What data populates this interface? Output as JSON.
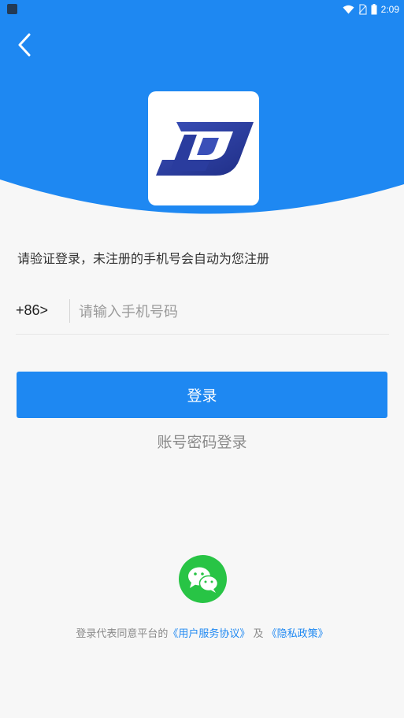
{
  "colors": {
    "header_blue": "#1e88f2",
    "button_blue": "#1e88f2",
    "wechat_green": "#28c445",
    "link_blue": "#1e88f2"
  },
  "status_bar": {
    "time": "2:09",
    "icons": [
      "app-notification-icon",
      "wifi-icon",
      "no-sim-icon",
      "battery-icon"
    ]
  },
  "header": {
    "back_icon": "chevron-left-icon",
    "logo_icon": "ld-logo"
  },
  "login": {
    "hint": "请验证登录，未注册的手机号会自动为您注册",
    "country_code": "+86>",
    "phone_placeholder": "请输入手机号码",
    "phone_value": "",
    "login_button_label": "登录",
    "password_login_label": "账号密码登录"
  },
  "third_party": {
    "wechat_icon": "wechat-icon"
  },
  "agreement": {
    "prefix": "登录代表同意平台的",
    "user_agreement": "《用户服务协议》",
    "conjunction": "及",
    "privacy_policy": "《隐私政策》"
  }
}
